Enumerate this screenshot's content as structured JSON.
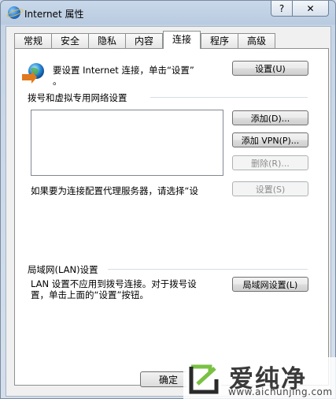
{
  "window": {
    "title": "Internet 属性",
    "help_label": "?",
    "close_label": "✕"
  },
  "tabs": [
    {
      "label": "常规"
    },
    {
      "label": "安全"
    },
    {
      "label": "隐私"
    },
    {
      "label": "内容"
    },
    {
      "label": "连接"
    },
    {
      "label": "程序"
    },
    {
      "label": "高级"
    }
  ],
  "active_tab": "连接",
  "setup": {
    "text_line1": "要设置 Internet 连接，单击“设置”",
    "text_line2": "。",
    "button": "设置(U)"
  },
  "dialup": {
    "group_title": "拨号和虚拟专用网络设置",
    "add_button": "添加(D)...",
    "add_vpn_button": "添加 VPN(P)...",
    "delete_button": "删除(R)...",
    "settings_button": "设置(S)",
    "proxy_text": "如果要为连接配置代理服务器，请选择“设"
  },
  "lan": {
    "group_title": "局域网(LAN)设置",
    "text_line1": "LAN 设置不应用到拨号连接。对于拨号设",
    "text_line2": "置，单击上面的“设置”按钮。",
    "button": "局域网设置(L)"
  },
  "footer": {
    "ok_button": "确定"
  },
  "watermark": {
    "text": "爱纯净",
    "url": "www.aichunjing.com"
  }
}
